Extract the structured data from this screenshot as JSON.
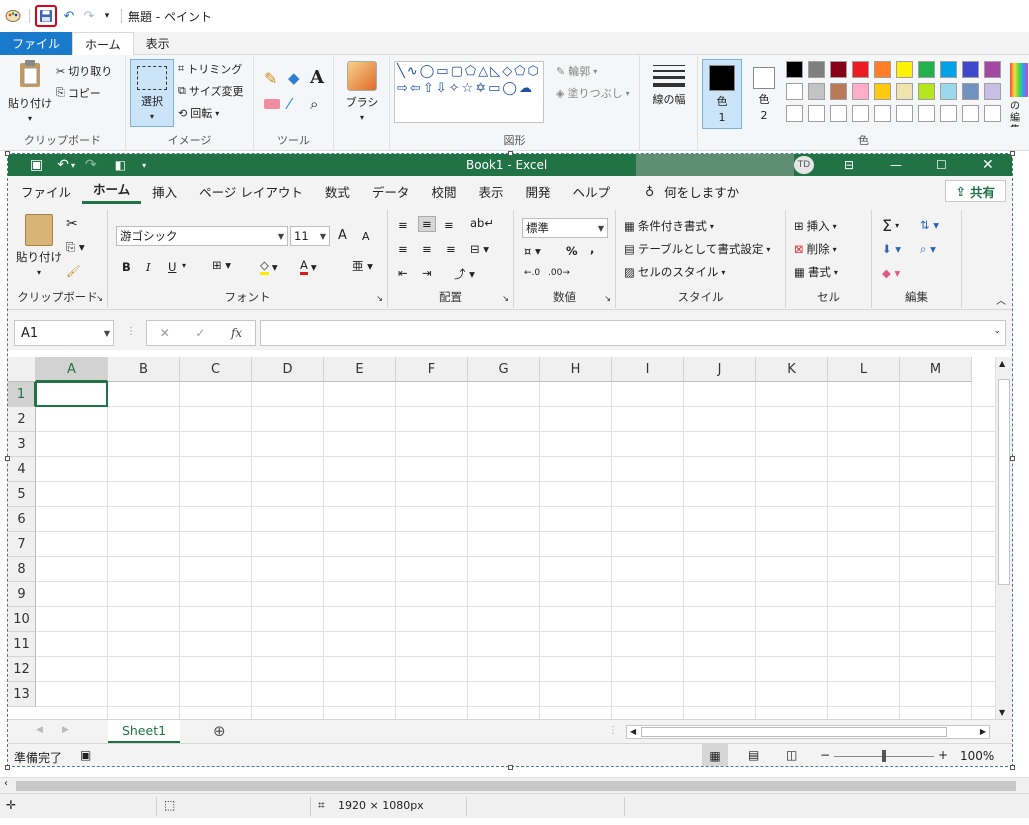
{
  "paint": {
    "title": "無題 - ペイント",
    "menu": {
      "file": "ファイル",
      "home": "ホーム",
      "view": "表示"
    },
    "clipboard": {
      "paste": "貼り付け",
      "cut": "切り取り",
      "copy": "コピー",
      "label": "クリップボード"
    },
    "image": {
      "select": "選択",
      "crop": "トリミング",
      "resize": "サイズ変更",
      "rotate": "回転",
      "label": "イメージ"
    },
    "tools": {
      "label": "ツール",
      "text_glyph": "A"
    },
    "brush": {
      "label": "ブラシ"
    },
    "shapes": {
      "outline": "輪郭",
      "fill": "塗りつぶし",
      "label": "図形"
    },
    "linewidth": {
      "label": "線の幅"
    },
    "colors": {
      "color1": "色",
      "color1_num": "1",
      "color2": "色",
      "color2_num": "2",
      "edit": "色の編集",
      "label": "色",
      "row1": [
        "#000000",
        "#7f7f7f",
        "#880015",
        "#ed1c24",
        "#ff7f27",
        "#fff200",
        "#22b14c",
        "#00a2e8",
        "#3f48cc",
        "#a349a4"
      ],
      "row2": [
        "#ffffff",
        "#c3c3c3",
        "#b97a57",
        "#ffaec9",
        "#ffc90e",
        "#efe4b0",
        "#b5e61d",
        "#99d9ea",
        "#7092be",
        "#c8bfe7"
      ]
    },
    "status": {
      "dimensions": "1920 × 1080px"
    }
  },
  "excel": {
    "title": "Book1  -  Excel",
    "user_initials": "TD",
    "tabs": [
      "ファイル",
      "ホーム",
      "挿入",
      "ページ レイアウト",
      "数式",
      "データ",
      "校閲",
      "表示",
      "開発",
      "ヘルプ"
    ],
    "search": "何をしますか",
    "share": "共有",
    "clipboard": {
      "paste": "貼り付け",
      "label": "クリップボード"
    },
    "font": {
      "name": "游ゴシック",
      "size": "11",
      "label": "フォント",
      "bold": "B",
      "italic": "I",
      "underline": "U",
      "grow": "A",
      "shrink": "A"
    },
    "alignment": {
      "label": "配置"
    },
    "number": {
      "format": "標準",
      "percent": "%",
      "comma": ",",
      "label": "数値"
    },
    "styles": {
      "conditional": "条件付き書式",
      "table": "テーブルとして書式設定",
      "cell": "セルのスタイル",
      "label": "スタイル"
    },
    "cells": {
      "insert": "挿入",
      "delete": "削除",
      "format": "書式",
      "label": "セル"
    },
    "editing": {
      "label": "編集"
    },
    "namebox": "A1",
    "fx": "fx",
    "columns": [
      "A",
      "B",
      "C",
      "D",
      "E",
      "F",
      "G",
      "H",
      "I",
      "J",
      "K",
      "L",
      "M"
    ],
    "rows": [
      "1",
      "2",
      "3",
      "4",
      "5",
      "6",
      "7",
      "8",
      "9",
      "10",
      "11",
      "12",
      "13"
    ],
    "sheet": "Sheet1",
    "status": "準備完了",
    "zoom": "100%"
  }
}
